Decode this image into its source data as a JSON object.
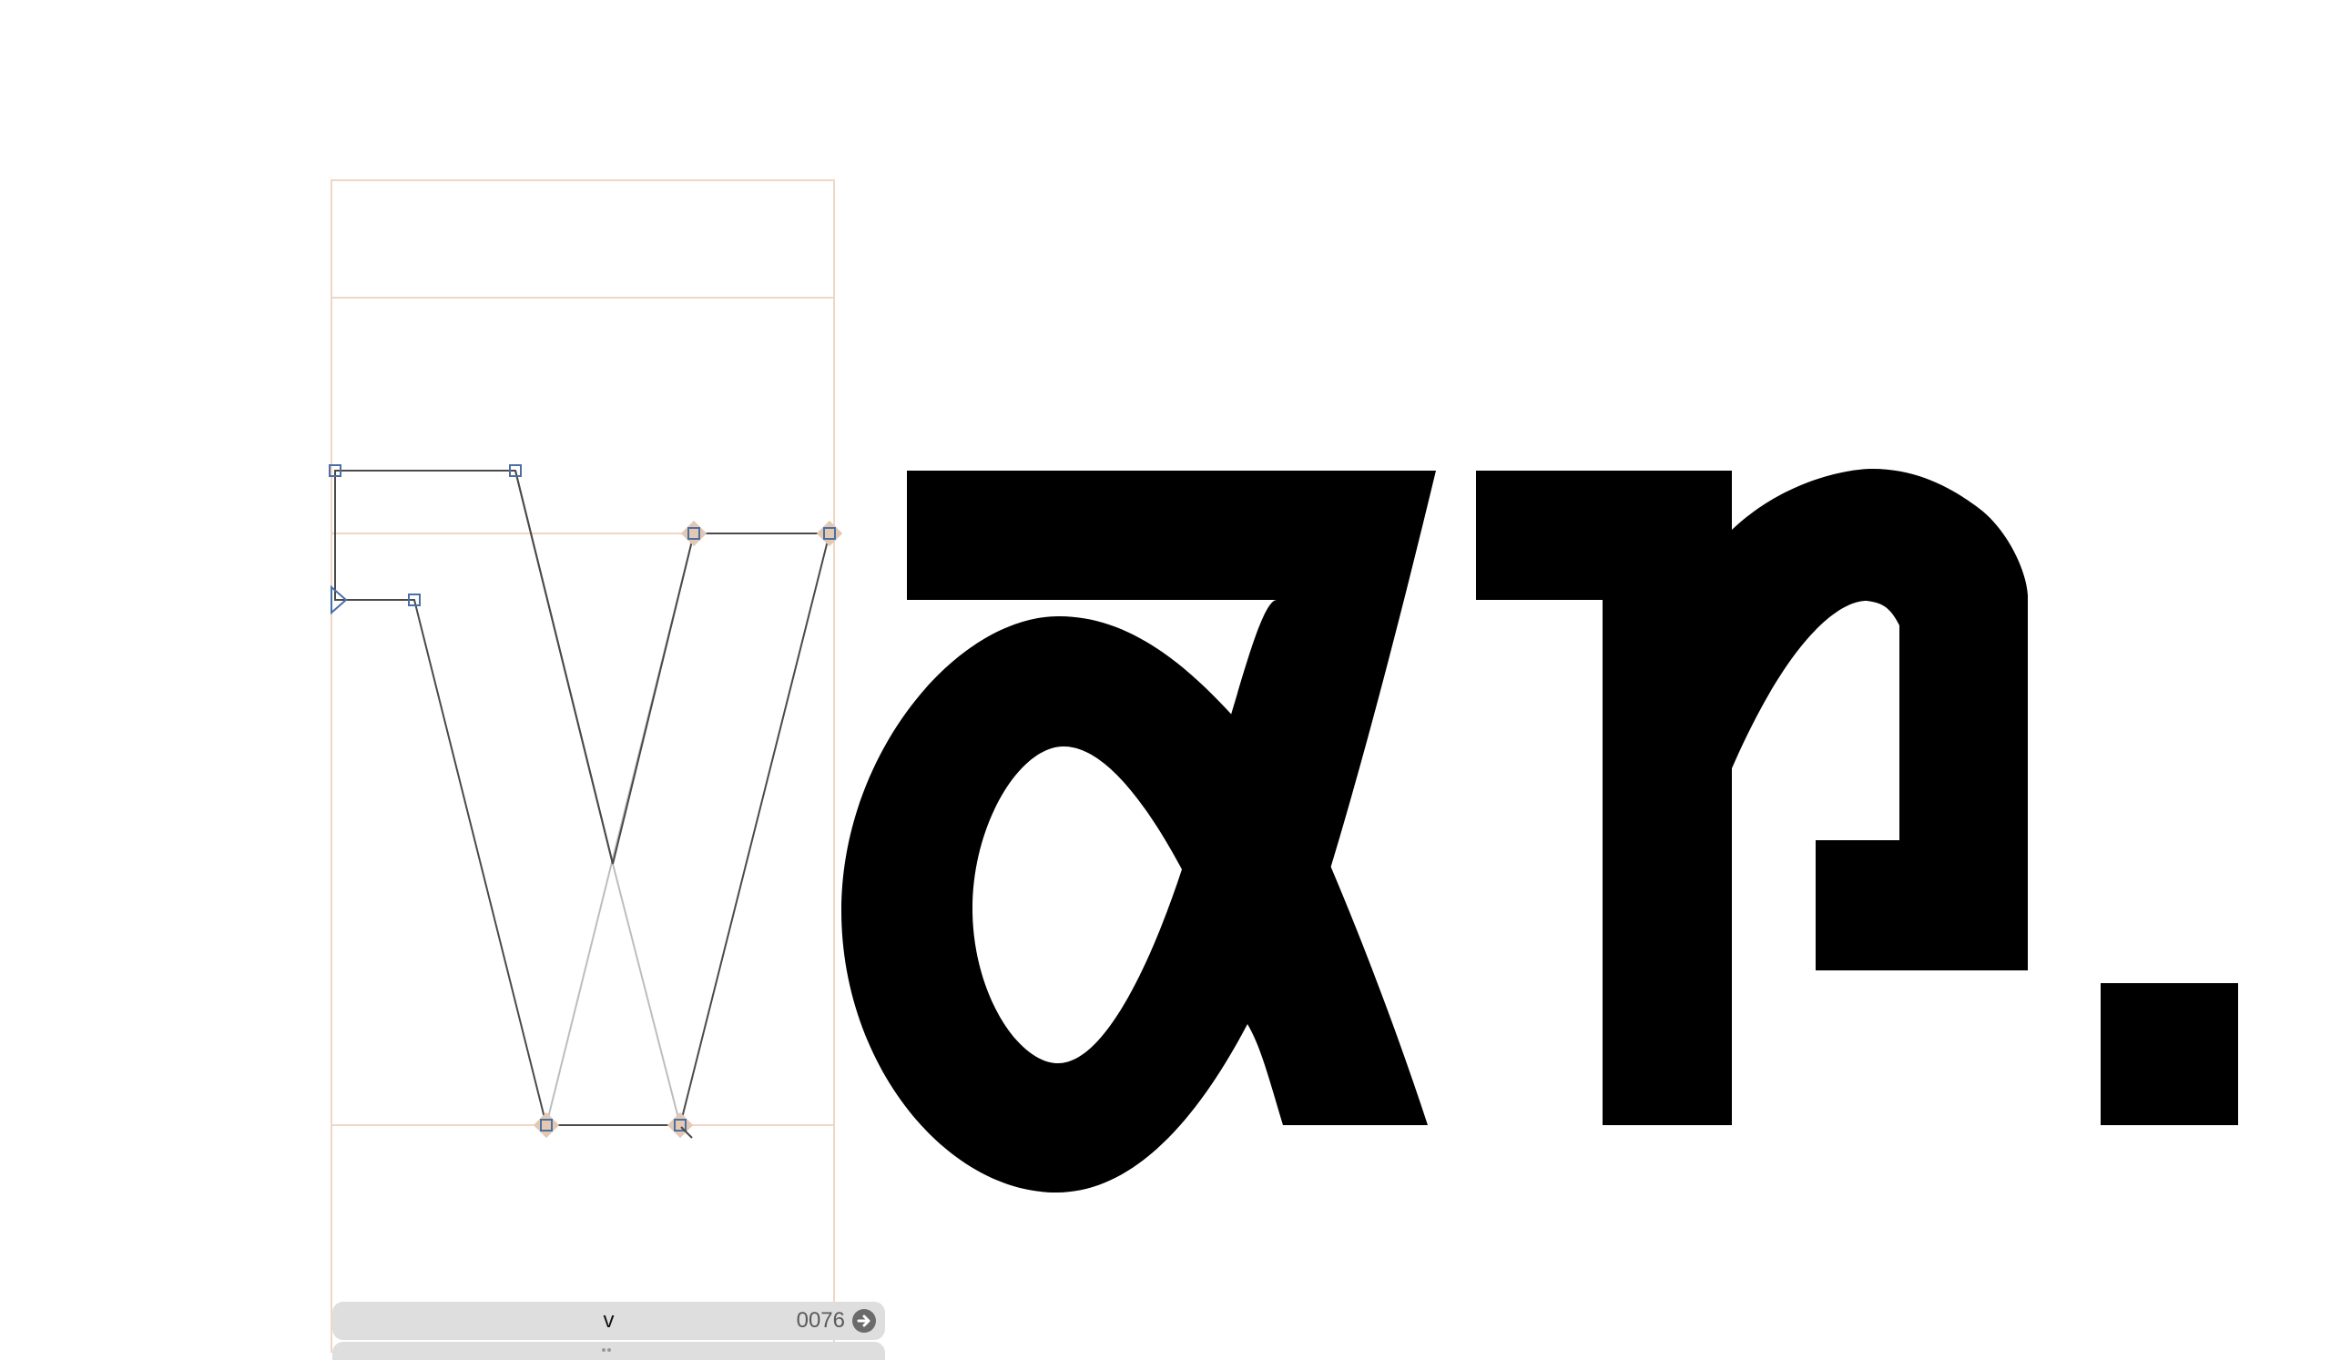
{
  "glyph_info": {
    "glyph_name": "v",
    "unicode": "0076"
  },
  "colors": {
    "background": "#ffffff",
    "metric_line": "#f0d6c6",
    "outline": "#4a4a4a",
    "node_square": "#4a6fa5",
    "smart_node": "#e3c9b2",
    "glyph_fill": "#000000",
    "info_bar": "#dedede"
  },
  "icons": {
    "next_glyph": "arrow-right-circle-icon",
    "start_node": "triangle-start-node-icon"
  },
  "preview_glyphs": [
    "a",
    "r",
    "."
  ]
}
